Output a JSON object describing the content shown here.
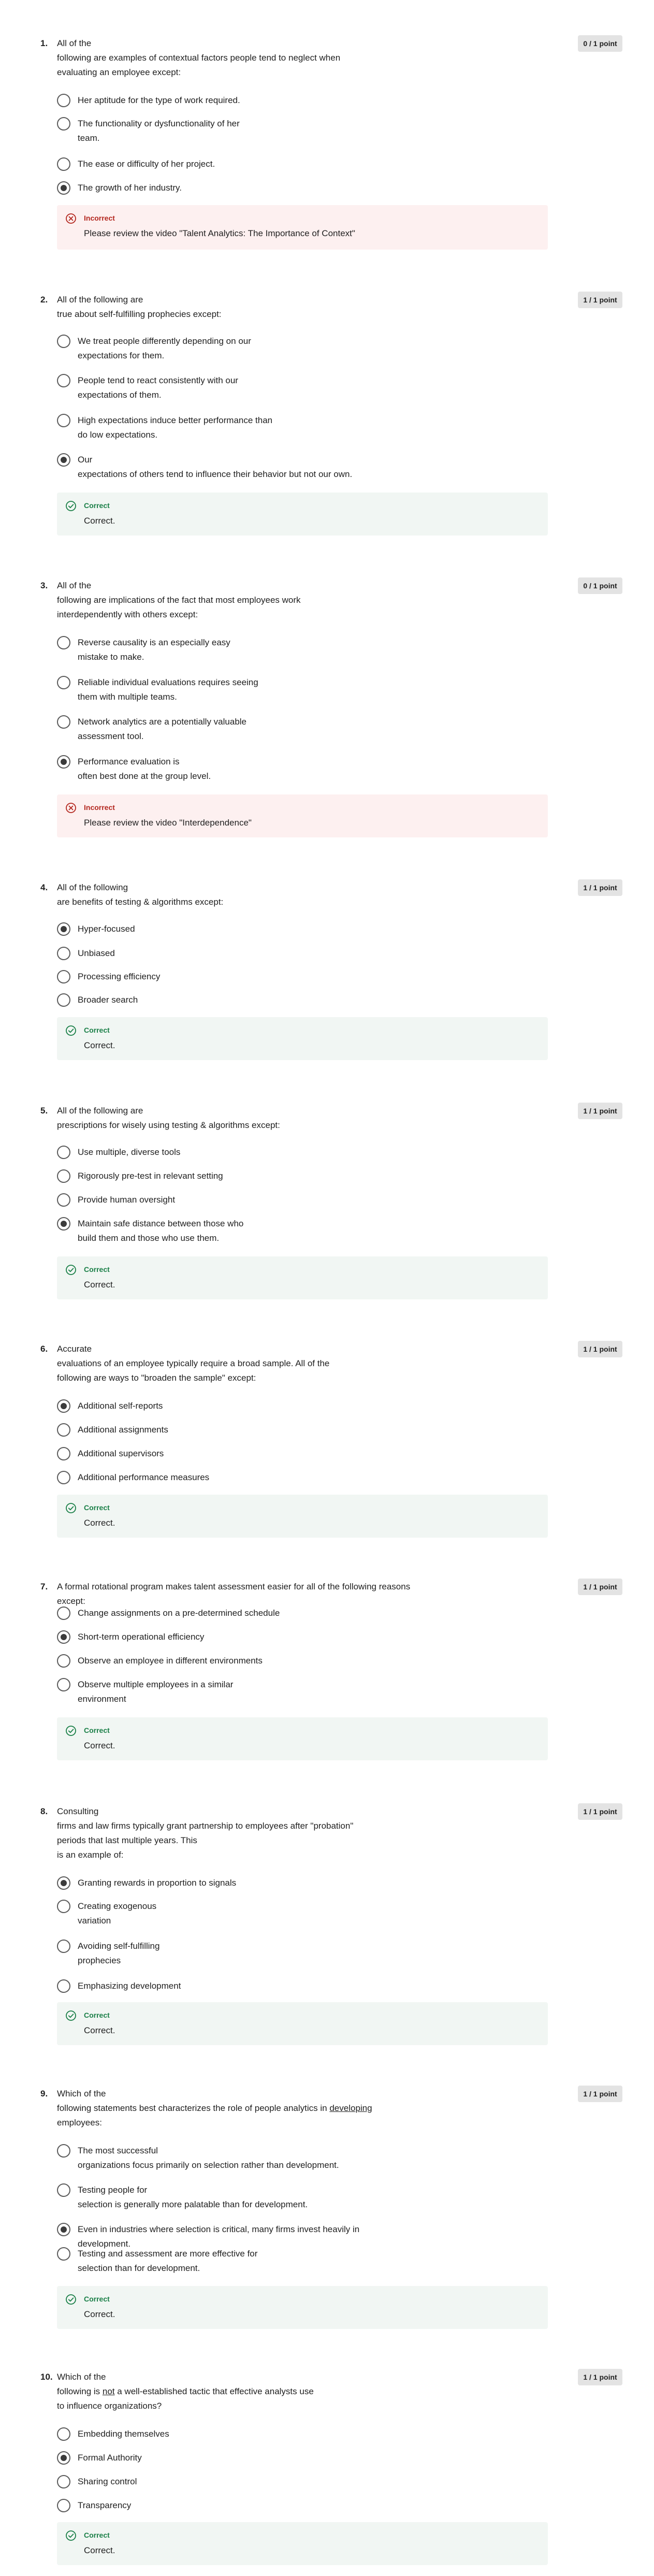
{
  "questions": [
    {
      "number": "1.",
      "text": "All of the\nfollowing are examples of contextual factors people tend to neglect when\nevaluating an employee except:",
      "score": "0 / 1 point",
      "options": [
        "Her aptitude for the type of work required.",
        "The functionality or dysfunctionality of her\nteam.",
        "The ease or difficulty of her project.",
        "The growth of her industry."
      ],
      "selected": 3,
      "feedback": {
        "status": "Incorrect",
        "message": "Please review the video \"Talent Analytics: The Importance of Context\""
      }
    },
    {
      "number": "2.",
      "text": "All of the following are\ntrue about self-fulfilling prophecies except:",
      "score": "1 / 1 point",
      "options": [
        "We treat people differently depending on our\nexpectations for them.",
        "People tend to react consistently with our\nexpectations of them.",
        "High expectations induce better performance than\ndo low expectations.",
        "Our\nexpectations of others tend to influence their behavior but not our own."
      ],
      "selected": 3,
      "feedback": {
        "status": "Correct",
        "message": "Correct."
      }
    },
    {
      "number": "3.",
      "text": "All of the\nfollowing are implications of the fact that most employees work\ninterdependently with others except:",
      "score": "0 / 1 point",
      "options": [
        "Reverse causality is an especially easy\nmistake to make.",
        "Reliable individual evaluations requires seeing\nthem with multiple teams.",
        "Network analytics are a potentially valuable\nassessment tool.",
        "Performance evaluation is\noften best done at the group level."
      ],
      "selected": 3,
      "feedback": {
        "status": "Incorrect",
        "message": "Please review the video \"Interdependence\""
      }
    },
    {
      "number": "4.",
      "text": "All of the following\nare benefits of testing & algorithms except:",
      "score": "1 / 1 point",
      "options": [
        "Hyper-focused",
        "Unbiased",
        "Processing efficiency",
        "Broader search"
      ],
      "selected": 0,
      "feedback": {
        "status": "Correct",
        "message": "Correct."
      }
    },
    {
      "number": "5.",
      "text": "All of the following are\nprescriptions for wisely using testing & algorithms except:",
      "score": "1 / 1 point",
      "options": [
        "Use multiple, diverse tools",
        "Rigorously pre-test in relevant setting",
        "Provide human oversight",
        "Maintain safe distance between those who\nbuild them and those who use them."
      ],
      "selected": 3,
      "feedback": {
        "status": "Correct",
        "message": "Correct."
      }
    },
    {
      "number": "6.",
      "text": "Accurate\nevaluations of an employee typically require a broad sample. All of the\nfollowing are ways to \"broaden the sample\" except:",
      "score": "1 / 1 point",
      "options": [
        "Additional self-reports",
        "Additional assignments",
        "Additional supervisors",
        "Additional performance measures"
      ],
      "selected": 0,
      "feedback": {
        "status": "Correct",
        "message": "Correct."
      }
    },
    {
      "number": "7.",
      "text": "A formal rotational program makes talent assessment easier for all of the following reasons except:",
      "score": "1 / 1 point",
      "options": [
        "Change assignments on a pre-determined schedule",
        "Short-term operational efficiency",
        "Observe an employee in different environments",
        "Observe multiple employees in a similar\nenvironment"
      ],
      "selected": 1,
      "feedback": {
        "status": "Correct",
        "message": "Correct."
      }
    },
    {
      "number": "8.",
      "text": "Consulting\nfirms and law firms typically grant partnership to employees after \"probation\"\nperiods that last multiple years.  This\nis an example of:",
      "score": "1 / 1 point",
      "options": [
        "Granting rewards in proportion to signals",
        "Creating exogenous\nvariation",
        "Avoiding self-fulfilling\nprophecies",
        "Emphasizing development"
      ],
      "selected": 0,
      "feedback": {
        "status": "Correct",
        "message": "Correct."
      }
    },
    {
      "number": "9.",
      "text_parts": [
        "Which of the\nfollowing statements best characterizes the role of people analytics in ",
        "developing",
        "\nemployees:"
      ],
      "score": "1 / 1 point",
      "options": [
        "The most successful\norganizations focus primarily on selection rather than development.",
        "Testing people for\nselection is generally more palatable than for development.",
        "Even in industries where selection is critical, many firms invest heavily in development.",
        "Testing and assessment are more effective for\nselection than for development."
      ],
      "selected": 2,
      "feedback": {
        "status": "Correct",
        "message": "Correct."
      }
    },
    {
      "number": "10.",
      "text_parts": [
        "Which of the\nfollowing is ",
        "not",
        " a well-established tactic that effective analysts use\nto influence organizations?"
      ],
      "score": "1 / 1 point",
      "options": [
        "Embedding themselves",
        "Formal Authority",
        "Sharing control",
        "Transparency"
      ],
      "selected": 1,
      "feedback": {
        "status": "Correct",
        "message": "Correct."
      }
    }
  ],
  "icons": {
    "incorrect": "x-circle-icon",
    "correct": "check-circle-icon"
  },
  "colors": {
    "incorrect": "#b3261e",
    "correct": "#1a7f47",
    "incorrect_bg": "#fdf0f0",
    "correct_bg": "#f1f6f3",
    "badge_bg": "#e3e3e3"
  }
}
